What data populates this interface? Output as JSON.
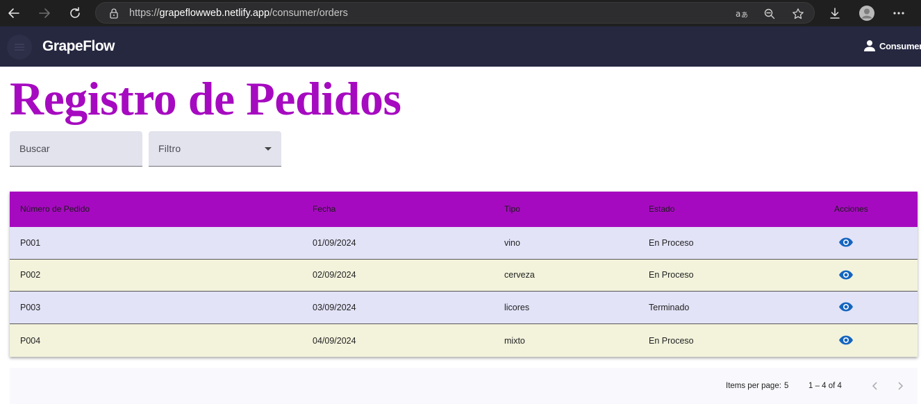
{
  "browser": {
    "url_prefix": "https://",
    "url_host": "grapeflowweb.netlify.app",
    "url_path": "/consumer/orders"
  },
  "app": {
    "brand": "GrapeFlow",
    "user_name": "Consumer"
  },
  "page": {
    "title": "Registro de Pedidos"
  },
  "filters": {
    "search_placeholder": "Buscar",
    "filter_label": "Filtro"
  },
  "table": {
    "headers": {
      "order_number": "Número de Pedido",
      "date": "Fecha",
      "type": "Tipo",
      "status": "Estado",
      "actions": "Acciones"
    },
    "rows": [
      {
        "order": "P001",
        "date": "01/09/2024",
        "type": "vino",
        "status": "En Proceso"
      },
      {
        "order": "P002",
        "date": "02/09/2024",
        "type": "cerveza",
        "status": "En Proceso"
      },
      {
        "order": "P003",
        "date": "03/09/2024",
        "type": "licores",
        "status": "Terminado"
      },
      {
        "order": "P004",
        "date": "04/09/2024",
        "type": "mixto",
        "status": "En Proceso"
      }
    ]
  },
  "paginator": {
    "items_per_page_label": "Items per page:",
    "items_per_page_value": "5",
    "range_label": "1 – 4 of 4"
  },
  "colors": {
    "accent": "#a60ac0",
    "toolbar": "#262840",
    "row_odd": "#e2e3f7",
    "row_even": "#f3f3dc",
    "eye_icon": "#1565c0"
  },
  "icons": {
    "back": "arrow-left-icon",
    "forward": "arrow-right-icon",
    "reload": "reload-icon",
    "lock": "lock-icon",
    "read_aloud": "read-aloud-icon",
    "zoom": "zoom-icon",
    "favorite": "star-icon",
    "download": "download-icon",
    "profile": "profile-icon",
    "more": "more-icon",
    "menu": "menu-icon",
    "user": "user-icon",
    "view": "eye-icon",
    "prev_page": "chevron-left-icon",
    "next_page": "chevron-right-icon"
  }
}
